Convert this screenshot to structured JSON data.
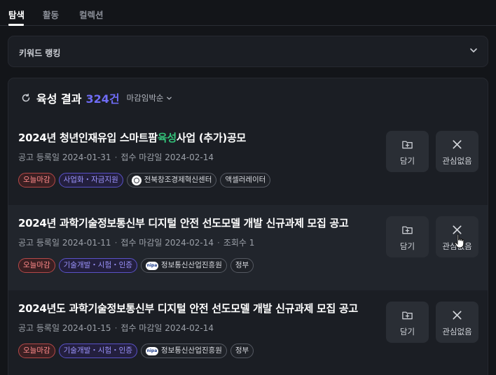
{
  "tabs": [
    {
      "label": "탐색",
      "active": true
    },
    {
      "label": "활동",
      "active": false
    },
    {
      "label": "컬렉션",
      "active": false
    }
  ],
  "keyword_panel": {
    "title": "키워드 랭킹",
    "icon": "chevron-down-icon"
  },
  "results": {
    "title": "육성 결과",
    "count": "324건",
    "sort_label": "마감임박순"
  },
  "cards": [
    {
      "title_pre": "2024년 청년인재유입 스마트팜",
      "title_hl": "육성",
      "title_post": "사업 (추가)공모",
      "registered": "공고 등록일 2024-01-31",
      "deadline": "접수 마감일 2024-02-14",
      "views": "",
      "tags": {
        "deadline": "오늘마감",
        "category": "사업화・자금지원",
        "org": "전북창조경제혁신센터",
        "extra": "액셀러레이터"
      },
      "save_label": "담기",
      "dismiss_label": "관심없음"
    },
    {
      "title_pre": "2024년 과학기술정보통신부 디지털 안전 선도모델 개발 신규과제 모집 공고",
      "title_hl": "",
      "title_post": "",
      "registered": "공고 등록일 2024-01-11",
      "deadline": "접수 마감일 2024-02-14",
      "views": "조회수 1",
      "tags": {
        "deadline": "오늘마감",
        "category": "기술개발・시험・인증",
        "org": "정보통신산업진흥원",
        "extra": "정부"
      },
      "save_label": "담기",
      "dismiss_label": "관심없음"
    },
    {
      "title_pre": "2024년도 과학기술정보통신부 디지털 안전 선도모델 개발 신규과제 모집 공고",
      "title_hl": "",
      "title_post": "",
      "registered": "공고 등록일 2024-01-15",
      "deadline": "접수 마감일 2024-02-14",
      "views": "",
      "tags": {
        "deadline": "오늘마감",
        "category": "기술개발・시험・인증",
        "org": "정보통신산업진흥원",
        "extra": "정부"
      },
      "save_label": "담기",
      "dismiss_label": "관심없음"
    }
  ],
  "org_logo_texts": [
    "nipa"
  ],
  "colors": {
    "accent": "#6f6cf6",
    "highlight": "#34c37a",
    "deadline": "#ff8a8a",
    "background": "#131519",
    "panel": "#1b1e24"
  }
}
